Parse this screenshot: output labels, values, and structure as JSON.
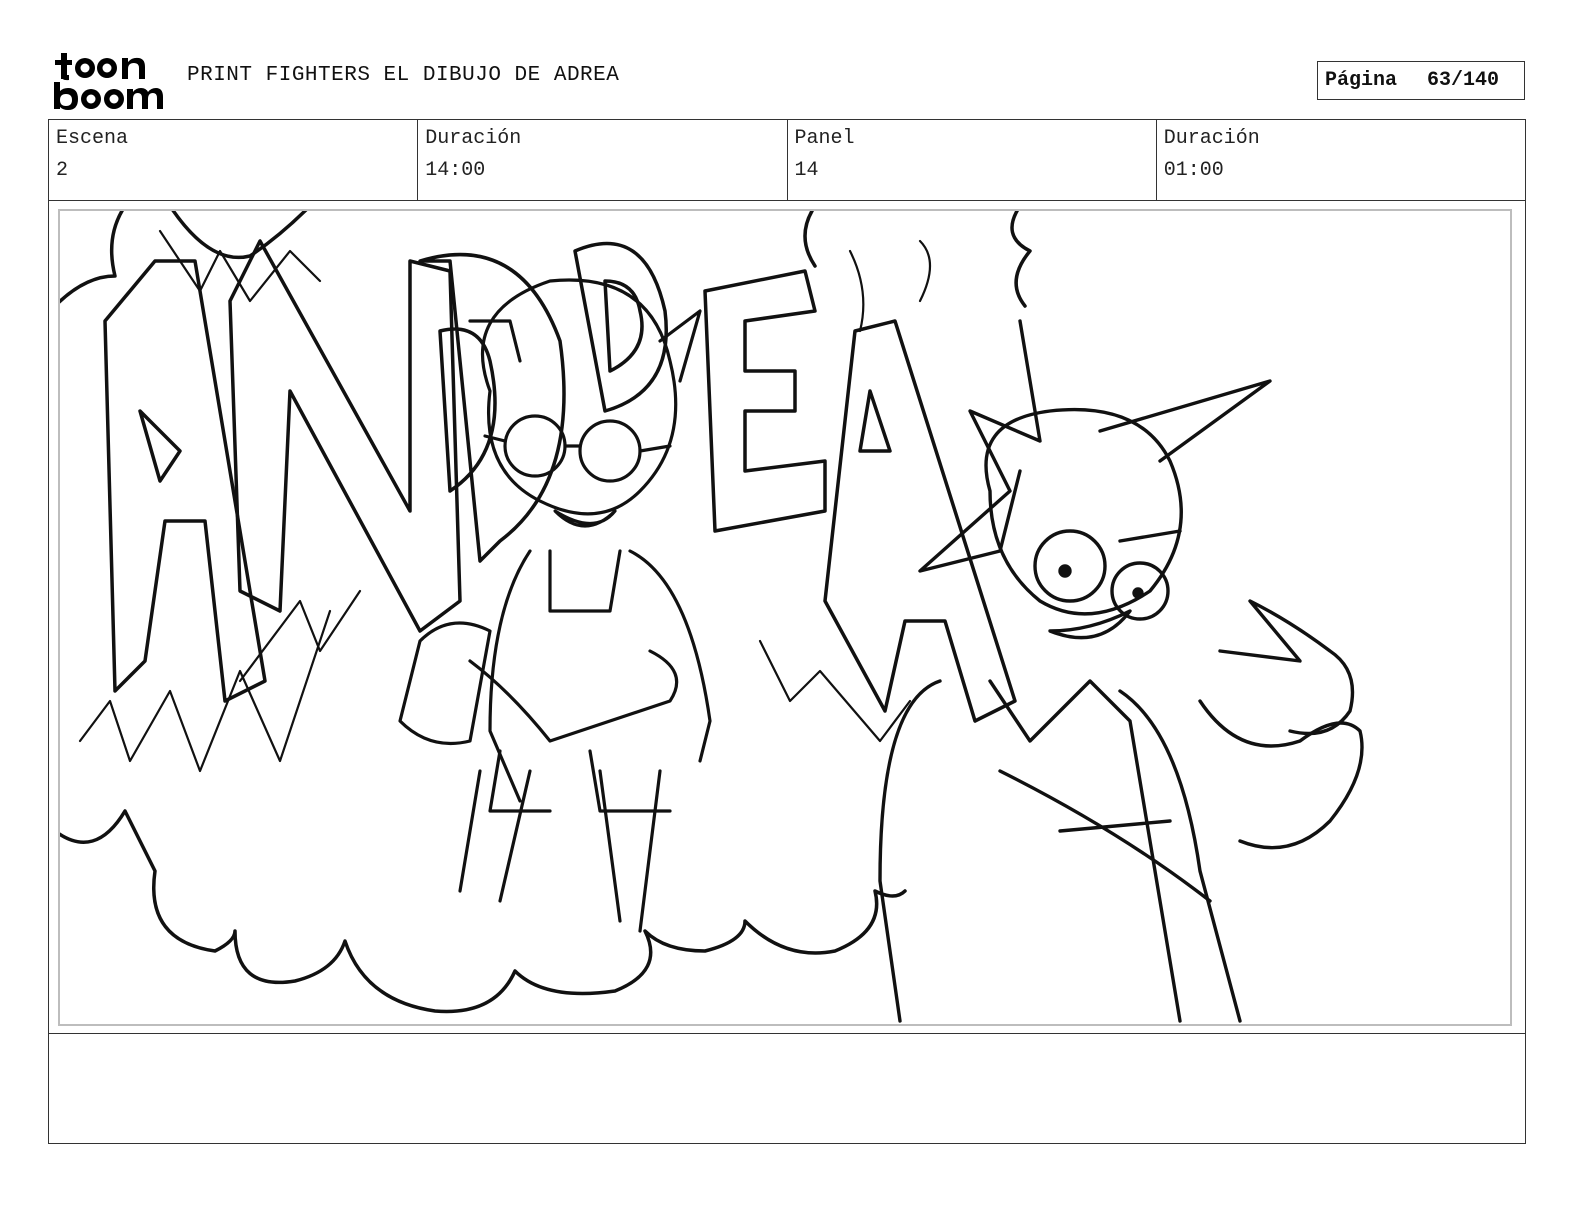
{
  "header": {
    "logo_top": "toon",
    "logo_bottom": "boom",
    "title": "PRINT FIGHTERS EL DIBUJO DE ADREA",
    "page_label": "Página",
    "page_value": "63/140"
  },
  "info": [
    {
      "label": "Escena",
      "value": "2"
    },
    {
      "label": "Duración",
      "value": "14:00"
    },
    {
      "label": "Panel",
      "value": "14"
    },
    {
      "label": "Duración",
      "value": "01:00"
    }
  ],
  "sketch": {
    "lettering": "ANDREA",
    "characters": [
      "girl-with-glasses-holding-cup",
      "spiky-haired-boy-pointing-at-self"
    ]
  },
  "notes": ""
}
